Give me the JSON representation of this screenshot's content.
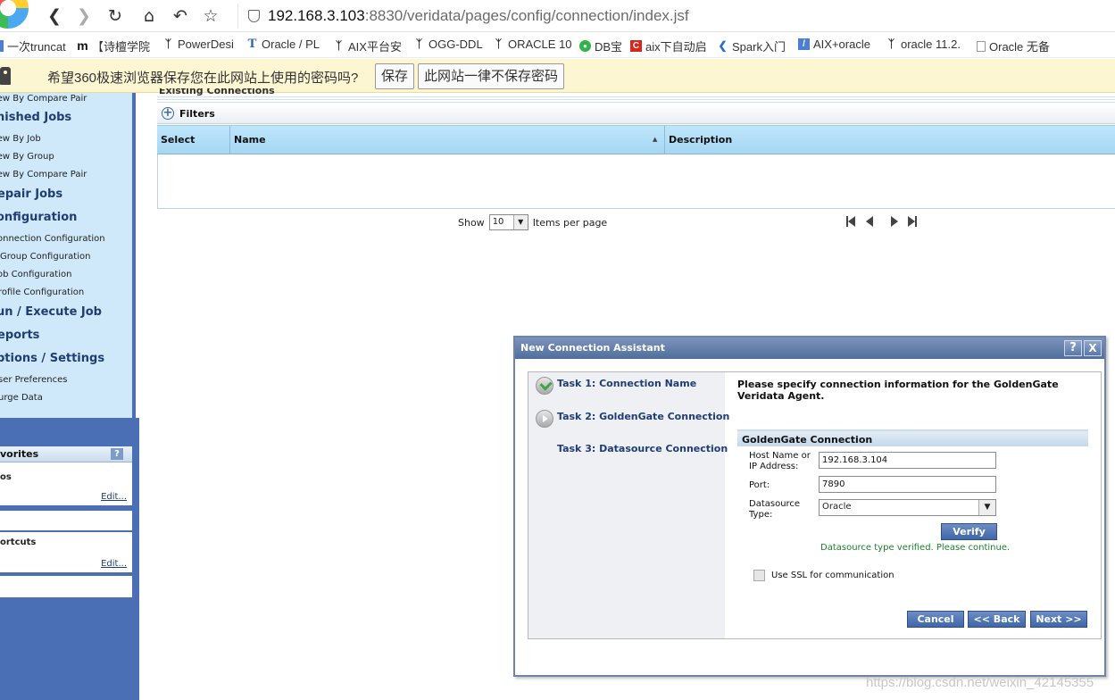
{
  "browser": {
    "url_host": "192.168.3.103",
    "url_rest": ":8830/veridata/pages/config/connection/index.jsf",
    "nav_icons": [
      "back-icon",
      "forward-icon",
      "refresh-icon",
      "home-icon",
      "undo-icon",
      "star-icon"
    ]
  },
  "bookmarks": [
    {
      "label": "一次truncat",
      "icon": "page-icon"
    },
    {
      "label": "【诗檀学院",
      "icon": "m-logo-icon"
    },
    {
      "label": "PowerDesi",
      "icon": "swirl-icon"
    },
    {
      "label": "Oracle / PL",
      "icon": "t-logo-icon"
    },
    {
      "label": "AIX平台安",
      "icon": "swirl-icon"
    },
    {
      "label": "OGG-DDL",
      "icon": "swirl-icon"
    },
    {
      "label": "ORACLE 10",
      "icon": "swirl-icon"
    },
    {
      "label": "DB宝",
      "icon": "wechat-icon"
    },
    {
      "label": "aix下自动启",
      "icon": "c-logo-icon"
    },
    {
      "label": "Spark入门",
      "icon": "code-icon"
    },
    {
      "label": "AIX+oracle",
      "icon": "slash-logo-icon"
    },
    {
      "label": "oracle 11.2.",
      "icon": "swirl-icon"
    },
    {
      "label": "Oracle 无备",
      "icon": "page-icon"
    }
  ],
  "password_bar": {
    "message": "希望360极速浏览器保存您在此网站上使用的密码吗?",
    "save_label": "保存",
    "never_label": "此网站一律不保存密码"
  },
  "nav": {
    "item_compare_pair_top": "iew By Compare Pair",
    "finished_jobs": "nished Jobs",
    "view_by_job": "iew By Job",
    "view_by_group": "iew By Group",
    "view_by_compare_pair": "iew By Compare Pair",
    "repair_jobs": "epair Jobs",
    "configuration": "onfiguration",
    "connection_configuration": "onnection Configuration",
    "group_configuration": "Group Configuration",
    "job_configuration": "ob Configuration",
    "profile_configuration": "rofile Configuration",
    "run_execute_job": "un / Execute Job",
    "reports": "eports",
    "options_settings": "ptions / Settings",
    "user_preferences": "ser Preferences",
    "purge_data": "urge Data"
  },
  "favorites": {
    "title": "vorites",
    "help": "?",
    "tips_label": "os",
    "edit_1": "Edit...",
    "shortcuts_label": "ortcuts",
    "edit_2": "Edit..."
  },
  "main": {
    "existing_connections": "Existing Connections",
    "filters_label": "Filters",
    "columns": {
      "select": "Select",
      "name": "Name",
      "description": "Description"
    },
    "pager": {
      "show": "Show",
      "per_page_value": "10",
      "items_per_page": "Items per page"
    }
  },
  "dialog": {
    "title": "New Connection Assistant",
    "help_icon": "?",
    "close_icon": "X",
    "tasks": [
      {
        "label": "Task 1: Connection Name",
        "status": "complete"
      },
      {
        "label": "Task 2: GoldenGate Connection",
        "status": "current"
      },
      {
        "label": "Task 3: Datasource Connection",
        "status": "pending"
      }
    ],
    "instructions": "Please specify connection information for the GoldenGate Veridata Agent.",
    "section_title": "GoldenGate Connection",
    "host_label_1": "Host Name or",
    "host_label_2": "IP Address:",
    "host_value": "192.168.3.104",
    "port_label": "Port:",
    "port_value": "7890",
    "dstype_label_1": "Datasource",
    "dstype_label_2": "Type:",
    "dstype_value": "Oracle",
    "verify_label": "Verify",
    "verified_msg": "Datasource type verified. Please continue.",
    "ssl_label": "Use SSL for communication",
    "ssl_checked": false,
    "cancel_label": "Cancel",
    "back_label": "<< Back",
    "next_label": "Next >>"
  },
  "watermark": "https://blog.csdn.net/weixin_42145355"
}
